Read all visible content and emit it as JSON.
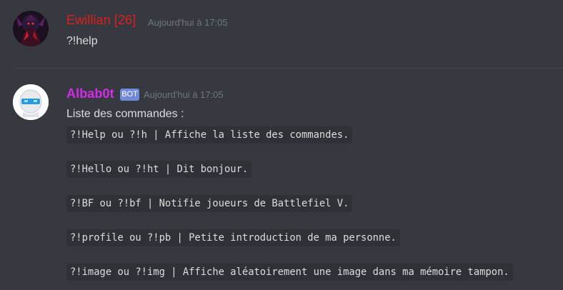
{
  "messages": [
    {
      "author": "Ewillian [26]",
      "timestamp": "Aujourd'hui à 17:05",
      "text": "?!help",
      "color": "#e01e1e"
    },
    {
      "author": "Albab0t",
      "bot_tag": "BOT",
      "timestamp": "Aujourd'hui à 17:05",
      "text": "Liste des commandes :",
      "color": "#d42be8",
      "commands": [
        "?!Help ou ?!h | Affiche la liste des commandes.",
        "?!Hello ou ?!ht | Dit bonjour.",
        "?!BF ou ?!bf | Notifie joueurs de Battlefiel V.",
        "?!profile ou ?!pb | Petite introduction de ma personne.",
        "?!image ou ?!img | Affiche aléatoirement une image dans ma mémoire tampon."
      ]
    }
  ],
  "colors": {
    "background": "#36393f",
    "code_background": "#2f3136",
    "text": "#dcddde",
    "timestamp": "#72767d",
    "bot_tag": "#7289da"
  }
}
